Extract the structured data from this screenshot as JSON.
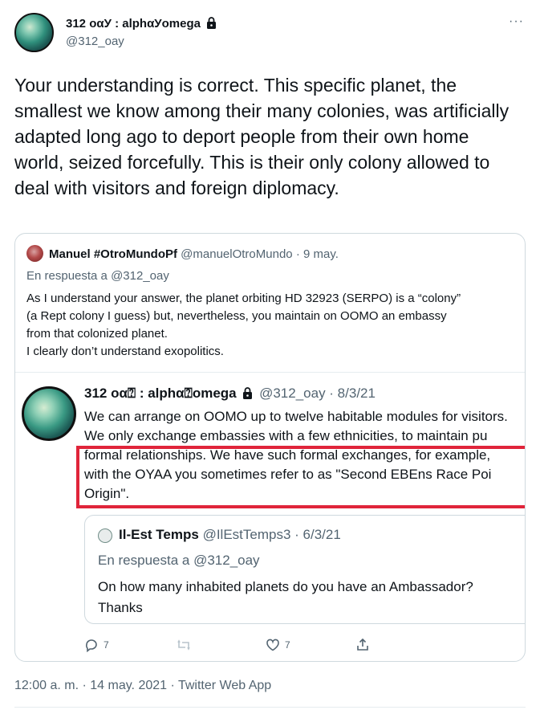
{
  "tweet": {
    "author_name": "312 οαУ : alphαУomega",
    "author_handle": "@312_oay",
    "text": "Your understanding is correct. This specific planet, the smallest we know among their many colonies, was artificially adapted long ago to deport people from their own home world, seized forcefully. This is their only colony allowed to deal with visitors and foreign diplomacy.",
    "timestamp": "12:00 a. m. · 14 may. 2021 · Twitter Web App",
    "more_label": "···"
  },
  "quote": {
    "author_name": "Manuel #OtroMundoPf",
    "author_handle": "@manuelOtroMundo",
    "date": "· 9 may.",
    "reply_to": "En respuesta a @312_oay",
    "text_lines": [
      "As I understand your answer, the planet orbiting HD 32923 (SERPO) is a “colony”",
      "(a Rept colony I guess) but, nevertheless, you maintain on OOMO an embassy",
      "from that colonized planet.",
      "I clearly don’t understand exopolitics."
    ]
  },
  "embedded": {
    "author_name": "312 οα⍰ : alphα⍰omega",
    "author_meta": "@312_oay · 8/3/21",
    "lines": [
      "We can arrange on OOMO up to twelve habitable modules for visitors.",
      "We only exchange embassies with a few ethnicities, to maintain pu",
      "formal relationships. We have such formal exchanges, for example,",
      "with the OYAA you sometimes refer to as \"Second EBEns Race Poi",
      "Origin\"."
    ],
    "inner": {
      "author_name": "Il-Est Temps",
      "author_meta": "@IlEstTemps3 · 6/3/21",
      "reply_to": "En respuesta a @312_oay",
      "text_lines": [
        "On how many inhabited planets do you have an Ambassador?",
        "Thanks"
      ]
    },
    "actions": {
      "reply_count": "7",
      "like_count": "7"
    }
  },
  "colors": {
    "highlight": "#e0243a",
    "secondary_text": "#536471",
    "border": "#cfd9de"
  },
  "icons": [
    "lock-icon",
    "more-icon",
    "reply-icon",
    "retweet-icon",
    "like-icon",
    "share-icon"
  ]
}
